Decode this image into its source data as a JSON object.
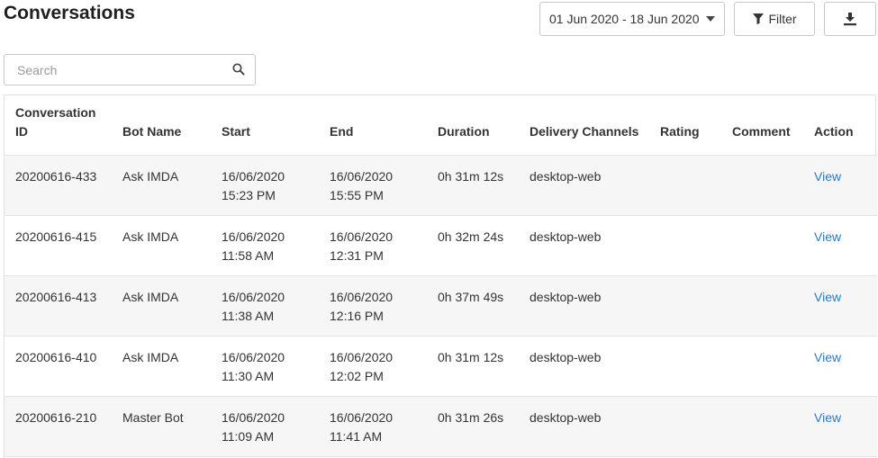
{
  "header": {
    "title": "Conversations"
  },
  "toolbar": {
    "date_range": "01 Jun 2020 - 18 Jun 2020",
    "filter_label": "Filter"
  },
  "search": {
    "placeholder": "Search",
    "value": ""
  },
  "table": {
    "columns": {
      "conversation_id_line1": "Conversation",
      "conversation_id_line2": "ID",
      "bot_name": "Bot Name",
      "start": "Start",
      "end": "End",
      "duration": "Duration",
      "delivery_channels": "Delivery Channels",
      "rating": "Rating",
      "comment": "Comment",
      "action": "Action"
    },
    "rows": [
      {
        "id": "20200616-433",
        "bot": "Ask IMDA",
        "start_date": "16/06/2020",
        "start_time": "15:23 PM",
        "end_date": "16/06/2020",
        "end_time": "15:55 PM",
        "duration": "0h 31m 12s",
        "channel": "desktop-web",
        "rating": "",
        "comment": "",
        "action": "View"
      },
      {
        "id": "20200616-415",
        "bot": "Ask IMDA",
        "start_date": "16/06/2020",
        "start_time": "11:58 AM",
        "end_date": "16/06/2020",
        "end_time": "12:31 PM",
        "duration": "0h 32m 24s",
        "channel": "desktop-web",
        "rating": "",
        "comment": "",
        "action": "View"
      },
      {
        "id": "20200616-413",
        "bot": "Ask IMDA",
        "start_date": "16/06/2020",
        "start_time": "11:38 AM",
        "end_date": "16/06/2020",
        "end_time": "12:16 PM",
        "duration": "0h 37m 49s",
        "channel": "desktop-web",
        "rating": "",
        "comment": "",
        "action": "View"
      },
      {
        "id": "20200616-410",
        "bot": "Ask IMDA",
        "start_date": "16/06/2020",
        "start_time": "11:30 AM",
        "end_date": "16/06/2020",
        "end_time": "12:02 PM",
        "duration": "0h 31m 12s",
        "channel": "desktop-web",
        "rating": "",
        "comment": "",
        "action": "View"
      },
      {
        "id": "20200616-210",
        "bot": "Master Bot",
        "start_date": "16/06/2020",
        "start_time": "11:09 AM",
        "end_date": "16/06/2020",
        "end_time": "11:41 AM",
        "duration": "0h 31m 26s",
        "channel": "desktop-web",
        "rating": "",
        "comment": "",
        "action": "View"
      }
    ]
  },
  "icons": {
    "filter": "filter-icon",
    "download": "download-icon",
    "search": "search-icon",
    "dropdown": "caret-down-icon"
  },
  "colors": {
    "link": "#2a7bc8",
    "row_stripe": "#f6f6f6",
    "border": "#c8c8c8"
  }
}
